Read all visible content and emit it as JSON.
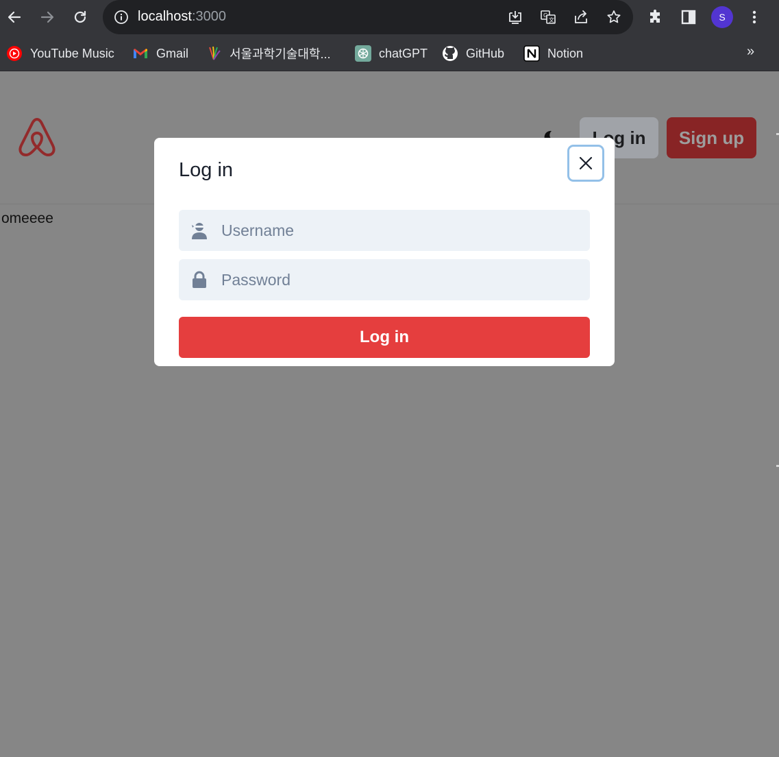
{
  "browser": {
    "url_host": "localhost",
    "url_port": ":3000",
    "profile_initial": "S",
    "icons": [
      "back-arrow-icon",
      "forward-arrow-icon",
      "reload-icon",
      "site-info-icon",
      "install-app-icon",
      "translate-icon",
      "share-icon",
      "bookmark-star-icon",
      "extensions-icon",
      "side-panel-icon",
      "more-menu-icon"
    ]
  },
  "bookmarks": {
    "items": [
      {
        "label": "YouTube Music",
        "icon": "youtube-music-icon"
      },
      {
        "label": "Gmail",
        "icon": "gmail-icon"
      },
      {
        "label": "서울과학기술대학...",
        "icon": "seoultech-icon"
      },
      {
        "label": "chatGPT",
        "icon": "chatgpt-icon"
      },
      {
        "label": "GitHub",
        "icon": "github-icon"
      },
      {
        "label": "Notion",
        "icon": "notion-icon"
      }
    ],
    "more": "»"
  },
  "header": {
    "login_label": "Log in",
    "signup_label": "Sign up"
  },
  "main": {
    "text": "omeeee"
  },
  "modal": {
    "title": "Log in",
    "username_placeholder": "Username",
    "password_placeholder": "Password",
    "submit_label": "Log in"
  },
  "colors": {
    "brand": "#e53e3e",
    "overlay": "#868686",
    "focus_ring": "#93c0e8",
    "input_bg": "#edf2f7"
  }
}
